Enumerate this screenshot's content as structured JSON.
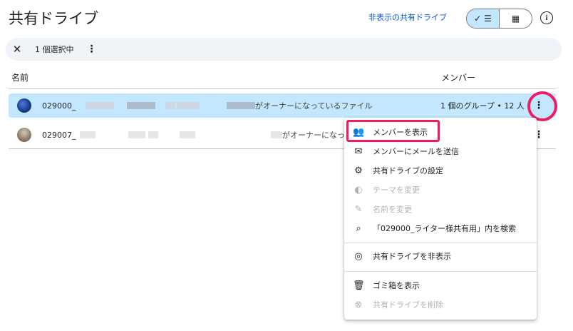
{
  "header": {
    "title": "共有ドライブ",
    "hidden_link": "非表示の共有ドライブ",
    "view_list_label": "✓ ☰",
    "view_grid_label": "▦",
    "info_label": "i"
  },
  "selection_bar": {
    "close": "✕",
    "text": "1 個選択中",
    "more": "⋮"
  },
  "columns": {
    "name": "名前",
    "members": "メンバー"
  },
  "rows": [
    {
      "name_prefix": "029000_",
      "name_suffix": "がオーナーになっているファイル",
      "members": "1 個のグループ • 12 人",
      "selected": true
    },
    {
      "name_prefix": "029007_",
      "name_suffix": "がオーナーになっ",
      "members": "",
      "selected": false
    }
  ],
  "row_more": "⋮",
  "menu": {
    "items": [
      {
        "icon": "people-icon",
        "glyph": "👥",
        "label": "メンバーを表示",
        "disabled": false
      },
      {
        "icon": "mail-icon",
        "glyph": "✉",
        "label": "メンバーにメールを送信",
        "disabled": false
      },
      {
        "icon": "gear-icon",
        "glyph": "⚙",
        "label": "共有ドライブの設定",
        "disabled": false
      },
      {
        "icon": "palette-icon",
        "glyph": "◐",
        "label": "テーマを変更",
        "disabled": true
      },
      {
        "icon": "pen-icon",
        "glyph": "✎",
        "label": "名前を変更",
        "disabled": true
      },
      {
        "icon": "search-icon",
        "glyph": "⌕",
        "label": "「029000_ライター様共有用」内を検索",
        "disabled": false
      },
      {
        "icon": "eye-off-icon",
        "glyph": "◎",
        "label": "共有ドライブを非表示",
        "disabled": false
      },
      {
        "icon": "trash-icon",
        "glyph": "🗑",
        "label": "ゴミ箱を表示",
        "disabled": false
      },
      {
        "icon": "cancel-icon",
        "glyph": "⊗",
        "label": "共有ドライブを削除",
        "disabled": true
      }
    ]
  },
  "colors": {
    "accent": "#0b57d0",
    "selected_bg": "#c2e7ff",
    "highlight": "#e91e63"
  }
}
